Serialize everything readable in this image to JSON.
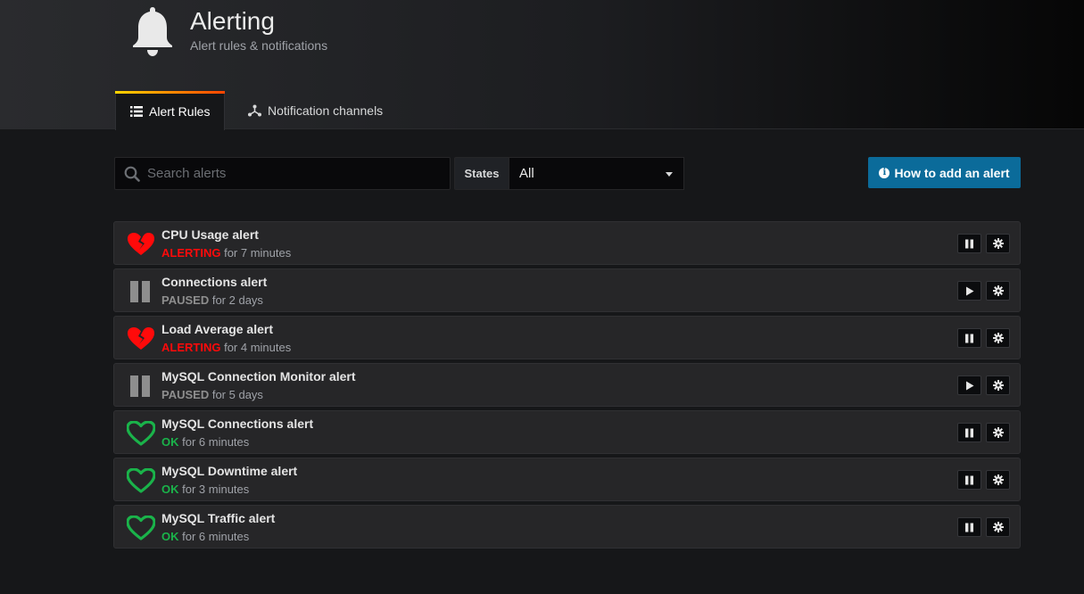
{
  "header": {
    "title": "Alerting",
    "subtitle": "Alert rules & notifications",
    "icon": "bell-icon"
  },
  "tabs": [
    {
      "label": "Alert Rules",
      "icon": "list-icon",
      "active": true
    },
    {
      "label": "Notification channels",
      "icon": "network-icon",
      "active": false
    }
  ],
  "filters": {
    "search_placeholder": "Search alerts",
    "search_value": "",
    "states_label": "States",
    "states_selected": "All"
  },
  "howto_button": {
    "label": "How to add an alert",
    "icon": "info-circle-icon"
  },
  "colors": {
    "alerting": "#ff0a0a",
    "paused": "#8e8e8e",
    "ok": "#1ab34a",
    "primary_button": "#0b6b9a"
  },
  "alerts": [
    {
      "name": "CPU Usage alert",
      "state": "ALERTING",
      "duration": "for 7 minutes",
      "state_icon": "broken-heart-icon",
      "toggle": "pause"
    },
    {
      "name": "Connections alert",
      "state": "PAUSED",
      "duration": "for 2 days",
      "state_icon": "pause-icon",
      "toggle": "play"
    },
    {
      "name": "Load Average alert",
      "state": "ALERTING",
      "duration": "for 4 minutes",
      "state_icon": "broken-heart-icon",
      "toggle": "pause"
    },
    {
      "name": "MySQL Connection Monitor alert",
      "state": "PAUSED",
      "duration": "for 5 days",
      "state_icon": "pause-icon",
      "toggle": "play"
    },
    {
      "name": "MySQL Connections alert",
      "state": "OK",
      "duration": "for 6 minutes",
      "state_icon": "heart-icon",
      "toggle": "pause"
    },
    {
      "name": "MySQL Downtime alert",
      "state": "OK",
      "duration": "for 3 minutes",
      "state_icon": "heart-icon",
      "toggle": "pause"
    },
    {
      "name": "MySQL Traffic alert",
      "state": "OK",
      "duration": "for 6 minutes",
      "state_icon": "heart-icon",
      "toggle": "pause"
    }
  ]
}
